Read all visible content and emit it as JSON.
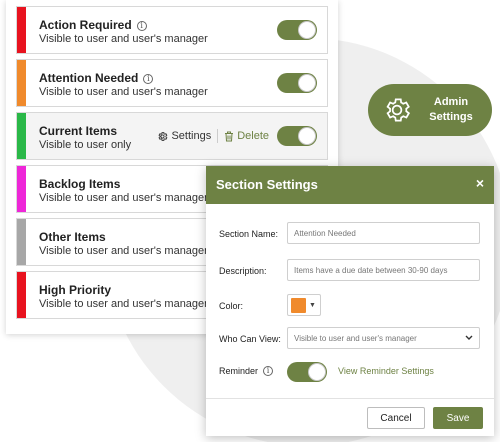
{
  "colors": {
    "accent": "#6e8244",
    "red": "#e8131f",
    "orange": "#f08a2c",
    "green": "#2ab848",
    "magenta": "#ee27d8",
    "gray": "#a7a7a7"
  },
  "sections": [
    {
      "title": "Action Required",
      "subtitle": "Visible to user and user's manager",
      "color": "#e8131f",
      "info_icon": true
    },
    {
      "title": "Attention Needed",
      "subtitle": "Visible to user and user's manager",
      "color": "#f08a2c",
      "info_icon": true
    },
    {
      "title": "Current Items",
      "subtitle": "Visible to user only",
      "color": "#2ab848",
      "info_icon": false
    },
    {
      "title": "Backlog Items",
      "subtitle": "Visible to user and user's manager",
      "color": "#ee27d8",
      "info_icon": false
    },
    {
      "title": "Other Items",
      "subtitle": "Visible to user and user's manager",
      "color": "#a7a7a7",
      "info_icon": false
    },
    {
      "title": "High Priority",
      "subtitle": "Visible to user and user's manager",
      "color": "#e8131f",
      "info_icon": false
    }
  ],
  "row_actions": {
    "settings_label": "Settings",
    "delete_label": "Delete"
  },
  "admin_button": {
    "line1": "Admin",
    "line2": "Settings"
  },
  "modal": {
    "title": "Section Settings",
    "close_glyph": "×",
    "name_label": "Section Name:",
    "name_value": "Attention Needed",
    "description_label": "Description:",
    "description_placeholder": "Items have a due date between 30-90 days",
    "color_label": "Color:",
    "color_value": "#f08a2c",
    "who_label": "Who Can View:",
    "who_value": "Visible to user and user's manager",
    "reminder_label": "Reminder",
    "reminder_link": "View Reminder Settings",
    "cancel_label": "Cancel",
    "save_label": "Save"
  }
}
